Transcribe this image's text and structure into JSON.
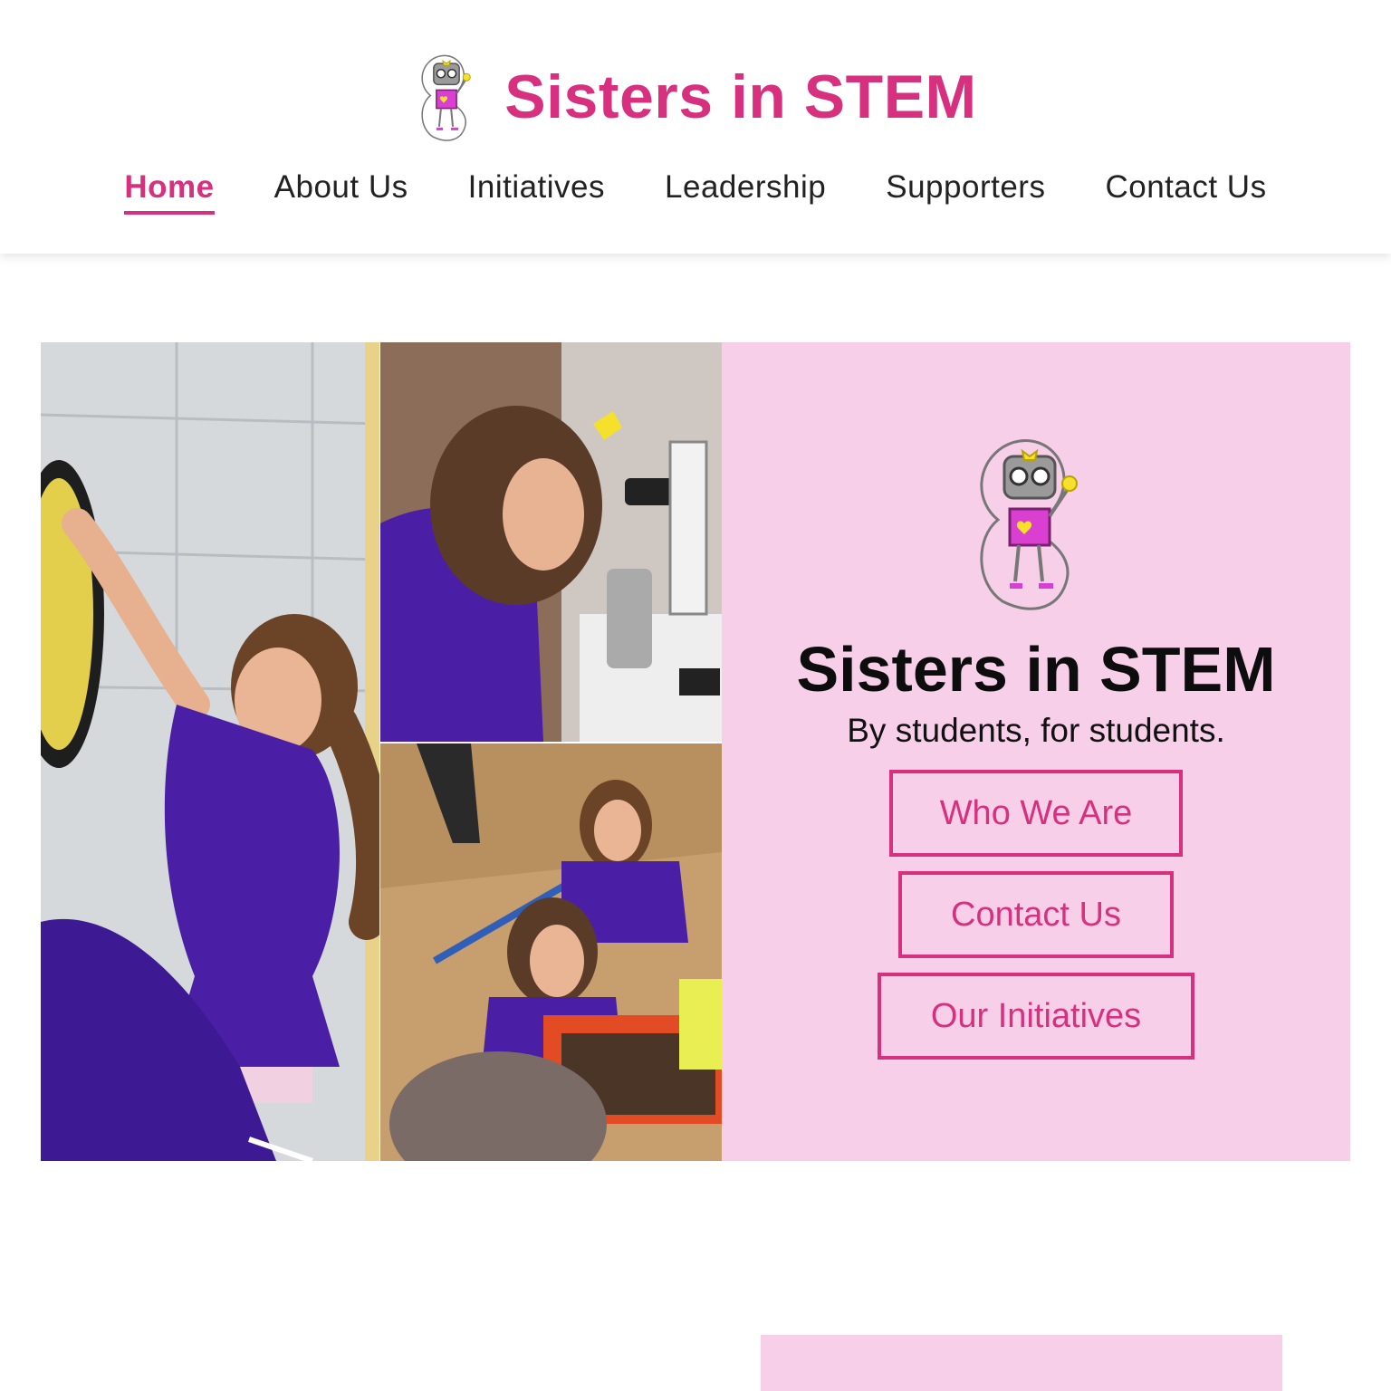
{
  "header": {
    "brand_title": "Sisters in STEM",
    "logo_icon": "robot-mascot-icon"
  },
  "nav": {
    "items": [
      {
        "label": "Home",
        "active": true
      },
      {
        "label": "About Us",
        "active": false
      },
      {
        "label": "Initiatives",
        "active": false
      },
      {
        "label": "Leadership",
        "active": false
      },
      {
        "label": "Supporters",
        "active": false
      },
      {
        "label": "Contact Us",
        "active": false
      }
    ]
  },
  "hero": {
    "title": "Sisters in STEM",
    "subtitle": "By students, for students.",
    "buttons": {
      "who_we_are": "Who We Are",
      "contact_us": "Contact Us",
      "our_initiatives": "Our Initiatives"
    },
    "photos": [
      {
        "alt": "girl reaching up at a robotics event"
      },
      {
        "alt": "girl looking into a microscope"
      },
      {
        "alt": "girls examining worms in soil"
      }
    ]
  },
  "colors": {
    "accent": "#d6307f",
    "panel_bg": "#f8cfe9",
    "text": "#111111",
    "shirt_purple": "#4a1fa6"
  }
}
